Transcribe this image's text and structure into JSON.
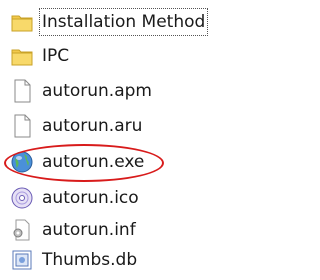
{
  "files": [
    {
      "name": "Installation Method",
      "icon": "folder-icon",
      "focused": true
    },
    {
      "name": "IPC",
      "icon": "folder-icon",
      "focused": false
    },
    {
      "name": "autorun.apm",
      "icon": "document-icon",
      "focused": false
    },
    {
      "name": "autorun.aru",
      "icon": "document-icon",
      "focused": false
    },
    {
      "name": "autorun.exe",
      "icon": "application-globe-icon",
      "focused": false,
      "circled": true
    },
    {
      "name": "autorun.ico",
      "icon": "disc-icon",
      "focused": false
    },
    {
      "name": "autorun.inf",
      "icon": "settings-file-icon",
      "focused": false
    },
    {
      "name": "Thumbs.db",
      "icon": "thumbnail-db-icon",
      "focused": false
    }
  ],
  "colors": {
    "highlight_ellipse": "#d81b1b",
    "folder": "#f2c94c"
  }
}
